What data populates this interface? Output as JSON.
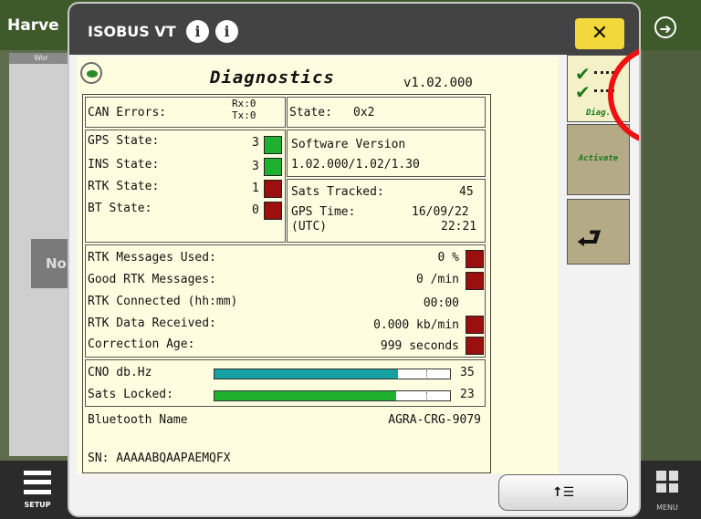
{
  "background": {
    "app_title": "Harve",
    "tab_label": "Wor",
    "left_panel_text": "No",
    "setup_label": "SETUP",
    "menu_label": "MENU"
  },
  "dialog": {
    "title": "ISOBUS VT",
    "close_symbol": "✕",
    "info_icon_1": "i",
    "info_icon_2": "i",
    "header": {
      "title": "Diagnostics",
      "version": "v1.02.000"
    },
    "can": {
      "label": "CAN Errors:",
      "rx": "Rx:0",
      "tx": "Tx:0"
    },
    "state": {
      "label": "State:",
      "value": "0x2"
    },
    "gps_states": [
      {
        "label": "GPS State:",
        "value": "3",
        "status": "green"
      },
      {
        "label": "INS State:",
        "value": "3",
        "status": "green"
      },
      {
        "label": "RTK State:",
        "value": "1",
        "status": "red"
      },
      {
        "label": "BT State:",
        "value": "0",
        "status": "red"
      }
    ],
    "software": {
      "label": "Software Version",
      "value": "1.02.000/1.02/1.30"
    },
    "sats": {
      "label": "Sats Tracked:",
      "value": "45"
    },
    "gps_time": {
      "label": "GPS Time:",
      "utc": "(UTC)",
      "date": "16/09/22",
      "time": "22:21"
    },
    "rtk_rows": [
      {
        "label": "RTK Messages Used:",
        "value": "0 %"
      },
      {
        "label": "Good RTK Messages:",
        "value": "0 /min"
      },
      {
        "label": "RTK Connected (hh:mm)",
        "value": "00:00"
      },
      {
        "label": "RTK Data Received:",
        "value": "0.000 kb/min"
      },
      {
        "label": "Correction Age:",
        "value": "999 seconds"
      }
    ],
    "cno": {
      "label": "CNO db.Hz",
      "value": "35",
      "fill": 0.78
    },
    "sats_locked": {
      "label": "Sats Locked:",
      "value": "23",
      "fill": 0.77
    },
    "bluetooth": {
      "label": "Bluetooth Name",
      "value": "AGRA-CRG-9079"
    },
    "sn": {
      "label": "SN: AAAAABQAAPAEMQFX"
    },
    "side_buttons": {
      "diag": "Diag.",
      "activate": "Activate"
    },
    "colors": {
      "green": "#20b030",
      "red": "#9b0f0f",
      "teal": "#16a0a0",
      "bar_green": "#20b030",
      "highlight": "#ee1111"
    }
  }
}
